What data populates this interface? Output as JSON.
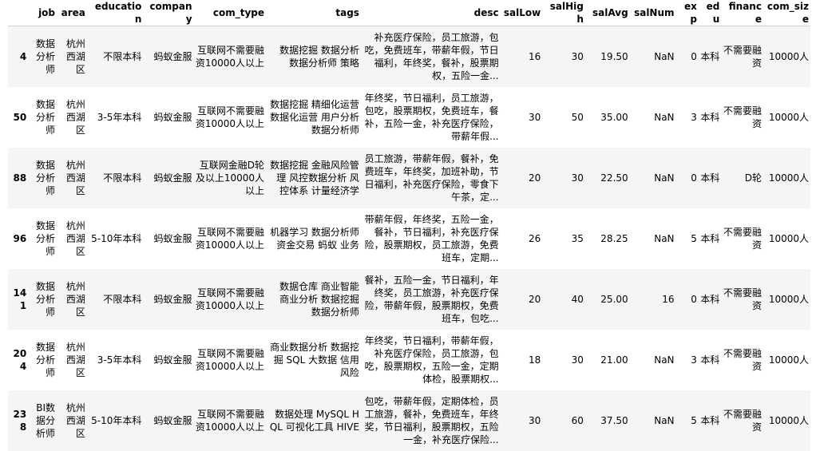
{
  "table": {
    "index_header": "",
    "columns": [
      "job",
      "area",
      "education",
      "company",
      "com_type",
      "tags",
      "desc",
      "salLow",
      "salHigh",
      "salAvg",
      "salNum",
      "exp",
      "edu",
      "finance",
      "com_size"
    ],
    "rows": [
      {
        "index": "4",
        "cells": [
          "数据分析师",
          "杭州西湖区",
          "不限本科",
          "蚂蚁金服",
          "互联网不需要融资10000人以上",
          "数据挖掘 数据分析 数据分析师 策略",
          "补充医疗保险，员工旅游，包吃，免费班车，带薪年假，节日福利，年终奖，餐补，股票期权，五险一金...",
          "16",
          "30",
          "19.50",
          "NaN",
          "0",
          "本科",
          "不需要融资",
          "10000人"
        ]
      },
      {
        "index": "50",
        "cells": [
          "数据分析师",
          "杭州西湖区",
          "3-5年本科",
          "蚂蚁金服",
          "互联网不需要融资10000人以上",
          "数据挖掘 精细化运营 数据化运营 用户分析 数据分析师",
          "年终奖，节日福利，员工旅游，包吃，股票期权，免费班车，餐补，五险一金，补充医疗保险，带薪年假...",
          "30",
          "50",
          "35.00",
          "NaN",
          "3",
          "本科",
          "不需要融资",
          "10000人"
        ]
      },
      {
        "index": "88",
        "cells": [
          "数据分析师",
          "杭州西湖区",
          "不限本科",
          "蚂蚁金服",
          "互联网金融D轮及以上10000人以上",
          "数据挖掘 金融风险管理 风控数据分析 风控体系 计量经济学",
          "员工旅游，带薪年假，餐补，免费班车，年终奖，加班补助，节日福利，补充医疗保险，零食下午茶，定...",
          "20",
          "30",
          "22.50",
          "NaN",
          "0",
          "本科",
          "D轮",
          "10000人"
        ]
      },
      {
        "index": "96",
        "cells": [
          "数据分析师",
          "杭州西湖区",
          "5-10年本科",
          "蚂蚁金服",
          "互联网不需要融资10000人以上",
          "机器学习 数据分析师 资金交易 蚂蚁 业务",
          "带薪年假，年终奖，五险一金，餐补，节日福利，补充医疗保险，股票期权，员工旅游，免费班车，定期...",
          "26",
          "35",
          "28.25",
          "NaN",
          "5",
          "本科",
          "不需要融资",
          "10000人"
        ]
      },
      {
        "index": "141",
        "cells": [
          "数据分析师",
          "杭州西湖区",
          "不限本科",
          "蚂蚁金服",
          "互联网不需要融资10000人以上",
          "数据仓库 商业智能 商业分析 数据挖掘 数据分析师",
          "餐补，五险一金，节日福利，年终奖，员工旅游，补充医疗保险，带薪年假，股票期权，免费班车，包吃...",
          "20",
          "40",
          "25.00",
          "16",
          "0",
          "本科",
          "不需要融资",
          "10000人"
        ]
      },
      {
        "index": "204",
        "cells": [
          "数据分析师",
          "杭州西湖区",
          "3-5年本科",
          "蚂蚁金服",
          "互联网不需要融资10000人以上",
          "商业数据分析 数据挖掘 SQL 大数据 信用风险",
          "年终奖，节日福利，带薪年假，补充医疗保险，员工旅游，包吃，股票期权，五险一金，定期体检，股票期权...",
          "18",
          "30",
          "21.00",
          "NaN",
          "3",
          "本科",
          "不需要融资",
          "10000人"
        ]
      },
      {
        "index": "238",
        "cells": [
          "BI数据分析师",
          "杭州西湖区",
          "5-10年本科",
          "蚂蚁金服",
          "互联网不需要融资10000人以上",
          "数据处理 MySQL HQL 可视化工具 HIVE",
          "包吃，带薪年假，定期体检，员工旅游，餐补，免费班车，年终奖，节日福利，股票期权，五险一金，补充医疗保险...",
          "30",
          "60",
          "37.50",
          "NaN",
          "5",
          "本科",
          "不需要融资",
          "10000人"
        ]
      }
    ]
  }
}
